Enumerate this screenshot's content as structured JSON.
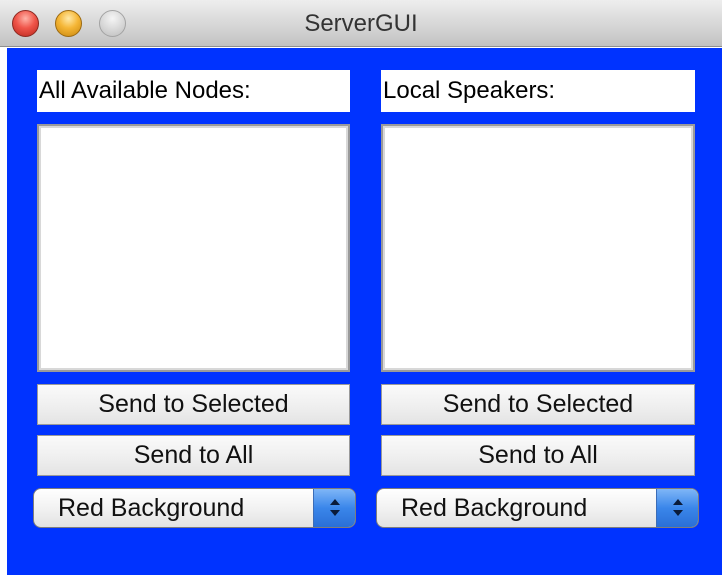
{
  "window": {
    "title": "ServerGUI"
  },
  "left_panel": {
    "heading": "All Available Nodes:",
    "send_selected_label": "Send to Selected",
    "send_all_label": "Send to All",
    "background_select_value": "Red Background"
  },
  "right_panel": {
    "heading": "Local Speakers:",
    "send_selected_label": "Send to Selected",
    "send_all_label": "Send to All",
    "background_select_value": "Red Background"
  },
  "colors": {
    "content_background": "#0033ff",
    "select_arrow_accent": "#3a86ea"
  },
  "icons": {
    "close": "close-circle-icon",
    "minimize": "minimize-circle-icon",
    "zoom": "zoom-circle-icon",
    "select_arrows": "up-down-arrows-icon"
  }
}
